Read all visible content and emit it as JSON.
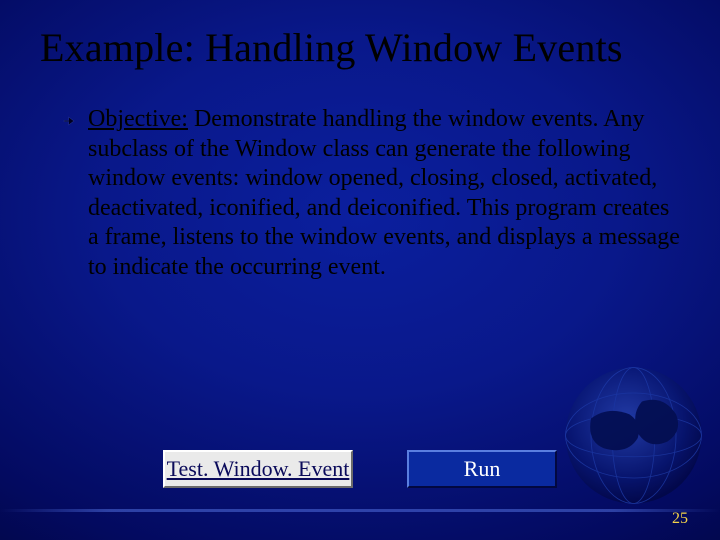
{
  "title": "Example: Handling Window Events",
  "bullet": {
    "icon": "pointing-hand-icon",
    "objective_label": "Objective:",
    "objective_text": " Demonstrate handling the window events. Any subclass of the Window class can generate the following window events: window opened, closing, closed, activated, deactivated, iconified, and deiconified. This program creates a frame, listens to the window events, and displays a message to indicate the occurring event."
  },
  "buttons": {
    "link_label": "Test. Window. Event",
    "run_label": "Run"
  },
  "page_number": "25"
}
